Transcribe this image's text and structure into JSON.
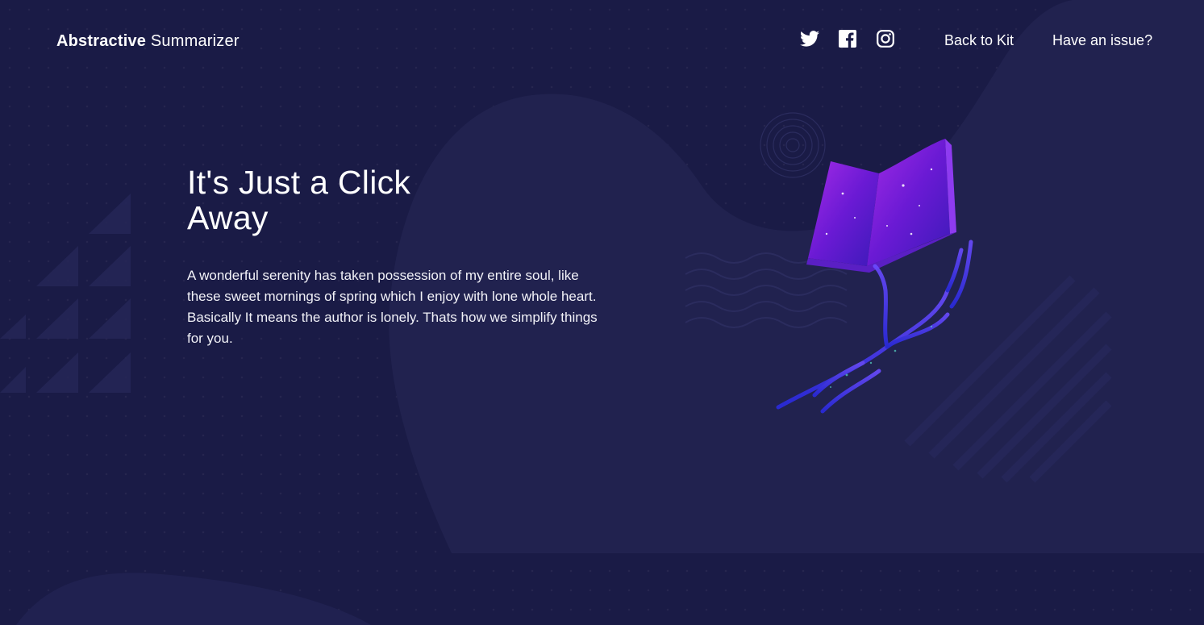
{
  "header": {
    "brand_bold": "Abstractive",
    "brand_light": " Summarizer",
    "social": [
      {
        "icon": "twitter-icon"
      },
      {
        "icon": "facebook-icon"
      },
      {
        "icon": "instagram-icon"
      }
    ],
    "nav": {
      "back_label": "Back to Kit",
      "issue_label": "Have an issue?"
    }
  },
  "hero": {
    "title": "It's Just a Click Away",
    "paragraph_1": "A wonderful serenity has taken possession of my entire soul, like these sweet mornings of spring which I enjoy with lone whole heart.",
    "paragraph_2": "Basically It means the author is lonely. Thats how we simplify things for you.",
    "illustration": "book-in-hand-illustration"
  },
  "colors": {
    "background": "#1a1b46",
    "blob": "#21224f",
    "text": "#ffffff",
    "accent_purple": "#7b1fd8"
  }
}
